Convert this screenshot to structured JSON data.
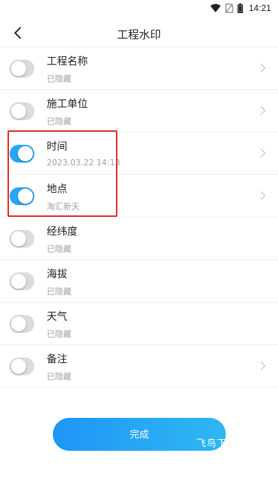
{
  "status_bar": {
    "time": "14:21"
  },
  "header": {
    "title": "工程水印"
  },
  "rows": [
    {
      "title": "工程名称",
      "subtitle": "已隐藏",
      "enabled": false,
      "has_chevron": true
    },
    {
      "title": "施工单位",
      "subtitle": "已隐藏",
      "enabled": false,
      "has_chevron": true
    },
    {
      "title": "时间",
      "subtitle": "2023.03.22 14:13",
      "enabled": true,
      "has_chevron": true
    },
    {
      "title": "地点",
      "subtitle": "淘汇新天",
      "enabled": true,
      "has_chevron": true
    },
    {
      "title": "经纬度",
      "subtitle": "已隐藏",
      "enabled": false,
      "has_chevron": false
    },
    {
      "title": "海拔",
      "subtitle": "已隐藏",
      "enabled": false,
      "has_chevron": false
    },
    {
      "title": "天气",
      "subtitle": "已隐藏",
      "enabled": false,
      "has_chevron": false
    },
    {
      "title": "备注",
      "subtitle": "已隐藏",
      "enabled": false,
      "has_chevron": true
    }
  ],
  "footer": {
    "done_label": "完成"
  },
  "watermark": "飞鸟下",
  "colors": {
    "accent": "#27a7f5",
    "toggle_off": "#dcdcdc",
    "highlight": "#e0201f"
  }
}
